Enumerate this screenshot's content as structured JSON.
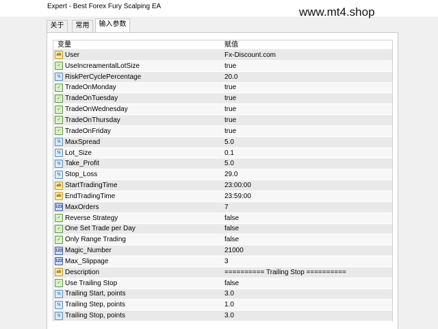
{
  "window": {
    "title": "Expert - Best Forex Fury Scalping EA"
  },
  "watermark": "www.mt4.shop",
  "tabs": [
    {
      "label": "关于"
    },
    {
      "label": "常用"
    },
    {
      "label": "输入参数"
    }
  ],
  "table": {
    "headers": {
      "variable": "变量",
      "value": "赋值"
    },
    "rows": [
      {
        "name": "User",
        "value": "Fx-Discount.com",
        "type": "string",
        "icon": "ab"
      },
      {
        "name": "UseIncreamentalLotSize",
        "value": "true",
        "type": "bool",
        "icon": "✓"
      },
      {
        "name": "RiskPerCyclePercentage",
        "value": "20.0",
        "type": "double",
        "icon": "½"
      },
      {
        "name": "TradeOnMonday",
        "value": "true",
        "type": "bool",
        "icon": "✓"
      },
      {
        "name": "TradeOnTuesday",
        "value": "true",
        "type": "bool",
        "icon": "✓"
      },
      {
        "name": "TradeOnWednesday",
        "value": "true",
        "type": "bool",
        "icon": "✓"
      },
      {
        "name": "TradeOnThursday",
        "value": "true",
        "type": "bool",
        "icon": "✓"
      },
      {
        "name": "TradeOnFriday",
        "value": "true",
        "type": "bool",
        "icon": "✓"
      },
      {
        "name": "MaxSpread",
        "value": "5.0",
        "type": "double",
        "icon": "½"
      },
      {
        "name": "Lot_Size",
        "value": "0.1",
        "type": "double",
        "icon": "½"
      },
      {
        "name": "Take_Profit",
        "value": "5.0",
        "type": "double",
        "icon": "½"
      },
      {
        "name": "Stop_Loss",
        "value": "29.0",
        "type": "double",
        "icon": "½"
      },
      {
        "name": "StartTradingTime",
        "value": "23:00:00",
        "type": "string",
        "icon": "ab"
      },
      {
        "name": "EndTradingTime",
        "value": "23:59:00",
        "type": "string",
        "icon": "ab"
      },
      {
        "name": "MaxOrders",
        "value": "7",
        "type": "int",
        "icon": "123"
      },
      {
        "name": "Reverse Strategy",
        "value": "false",
        "type": "bool",
        "icon": "✓"
      },
      {
        "name": "One Set Trade per Day",
        "value": "false",
        "type": "bool",
        "icon": "✓"
      },
      {
        "name": "Only Range Trading",
        "value": "false",
        "type": "bool",
        "icon": "✓"
      },
      {
        "name": "Magic_Number",
        "value": "21000",
        "type": "int",
        "icon": "123"
      },
      {
        "name": "Max_Slippage",
        "value": "3",
        "type": "int",
        "icon": "123"
      },
      {
        "name": "Description",
        "value": "========== Trailing Stop ==========",
        "type": "string",
        "icon": "ab"
      },
      {
        "name": "Use Trailing Stop",
        "value": "false",
        "type": "bool",
        "icon": "✓"
      },
      {
        "name": "Trailing Start, points",
        "value": "3.0",
        "type": "double",
        "icon": "½"
      },
      {
        "name": "Trailing Step, points",
        "value": "1.0",
        "type": "double",
        "icon": "½"
      },
      {
        "name": "Trailing Stop, points",
        "value": "3.0",
        "type": "double",
        "icon": "½"
      }
    ]
  }
}
